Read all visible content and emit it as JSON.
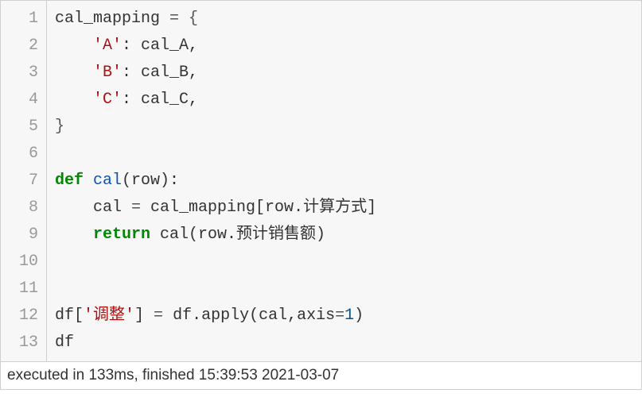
{
  "gutter": {
    "lines": [
      "1",
      "2",
      "3",
      "4",
      "5",
      "6",
      "7",
      "8",
      "9",
      "10",
      "11",
      "12",
      "13"
    ]
  },
  "code": {
    "l1": {
      "a": "cal_mapping ",
      "b": "=",
      "c": " {"
    },
    "l2": {
      "a": "    ",
      "b": "'A'",
      "c": ": cal_A,"
    },
    "l3": {
      "a": "    ",
      "b": "'B'",
      "c": ": cal_B,"
    },
    "l4": {
      "a": "    ",
      "b": "'C'",
      "c": ": cal_C,"
    },
    "l5": {
      "a": "}"
    },
    "l6": {
      "a": ""
    },
    "l7": {
      "a": "def",
      "b": " ",
      "c": "cal",
      "d": "(row):"
    },
    "l8": {
      "a": "    cal ",
      "b": "=",
      "c": " cal_mapping[row.计算方式]"
    },
    "l9": {
      "a": "    ",
      "b": "return",
      "c": " cal(row.预计销售额)"
    },
    "l10": {
      "a": ""
    },
    "l11": {
      "a": ""
    },
    "l12": {
      "a": "df[",
      "b": "'调整'",
      "c": "] ",
      "d": "=",
      "e": " df.apply(cal,axis",
      "f": "=",
      "g": "1",
      "h": ")"
    },
    "l13": {
      "a": "df"
    }
  },
  "status": {
    "text": "executed in 133ms, finished 15:39:53 2021-03-07"
  }
}
